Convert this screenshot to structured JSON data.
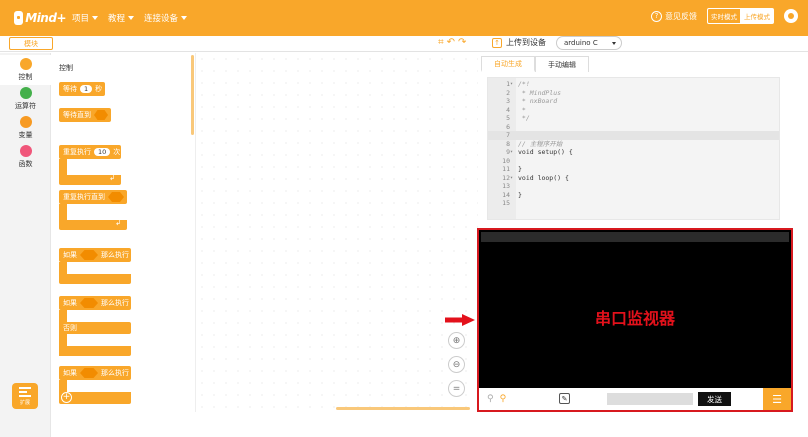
{
  "header": {
    "logo_text": "Mind+",
    "menu": [
      "项目",
      "教程",
      "连接设备"
    ],
    "feedback_label": "意见反馈",
    "mode_realtime": "实时模式",
    "mode_upload": "上传模式"
  },
  "toolbar": {
    "module_tab": "模块",
    "upload_label": "上传到设备",
    "board_selected": "arduino C"
  },
  "categories": [
    {
      "label": "控制",
      "color": "#f9a72a"
    },
    {
      "label": "运算符",
      "color": "#44b04b"
    },
    {
      "label": "变量",
      "color": "#f79a22"
    },
    {
      "label": "函数",
      "color": "#f0567a"
    }
  ],
  "extension_label": "扩展",
  "palette": {
    "title": "控制",
    "blocks": {
      "wait": "等待",
      "wait_value": "1",
      "wait_unit": "秒",
      "wait_until": "等待直到",
      "repeat": "重复执行",
      "repeat_value": "10",
      "repeat_unit": "次",
      "repeat_until": "重复执行直到",
      "if_1": "如果",
      "then_1": "那么执行",
      "if_2": "如果",
      "then_2": "那么执行",
      "else": "否则",
      "if_3": "如果",
      "then_3": "那么执行"
    }
  },
  "code_panel": {
    "tabs": [
      "自动生成",
      "手动编辑"
    ],
    "lines": [
      {
        "n": "1",
        "fold": "▾",
        "text": "/*!",
        "comment": true
      },
      {
        "n": "2",
        "text": " * MindPlus",
        "comment": true
      },
      {
        "n": "3",
        "text": " * nxBoard",
        "comment": true
      },
      {
        "n": "4",
        "text": " *",
        "comment": true
      },
      {
        "n": "5",
        "text": " */",
        "comment": true
      },
      {
        "n": "6",
        "text": ""
      },
      {
        "n": "7",
        "text": ""
      },
      {
        "n": "8",
        "text": "// 主程序开始",
        "comment": true
      },
      {
        "n": "9",
        "fold": "▾",
        "text": "void setup() {"
      },
      {
        "n": "10",
        "text": ""
      },
      {
        "n": "11",
        "text": "}"
      },
      {
        "n": "12",
        "fold": "▾",
        "text": "void loop() {"
      },
      {
        "n": "13",
        "text": ""
      },
      {
        "n": "14",
        "text": "}"
      },
      {
        "n": "15",
        "text": ""
      }
    ]
  },
  "monitor": {
    "title": "串口监视器",
    "send_label": "发送",
    "input_value": ""
  }
}
